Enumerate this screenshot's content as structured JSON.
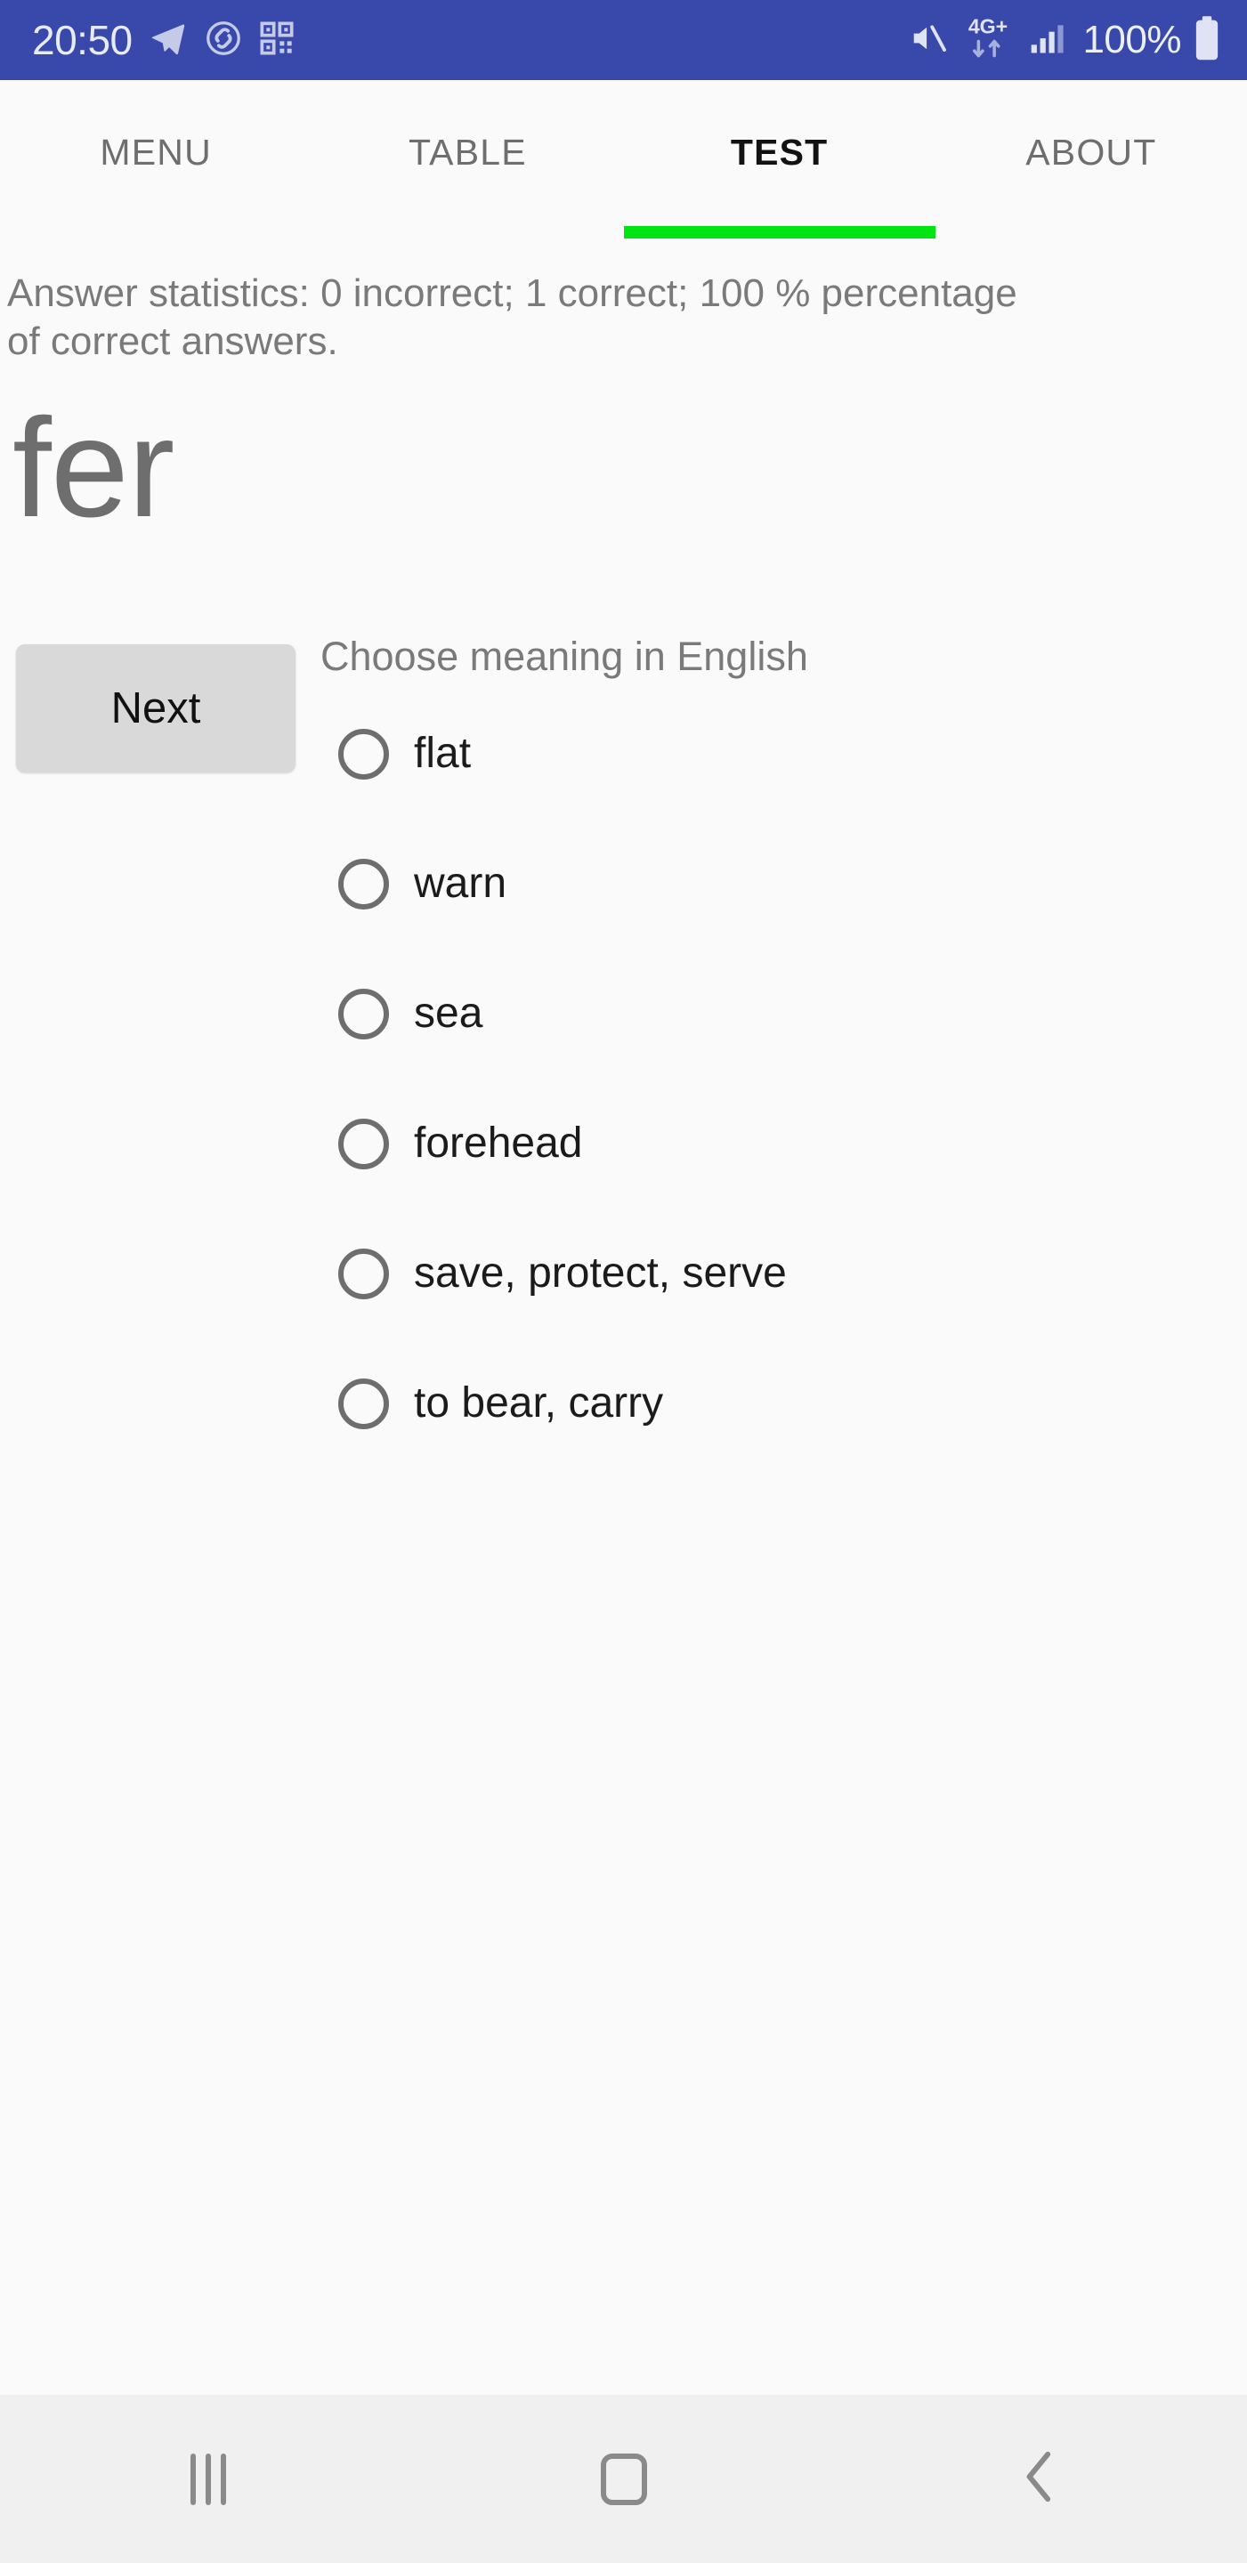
{
  "status_bar": {
    "time": "20:50",
    "battery_percent": "100%",
    "network": "4G+",
    "left_icons": [
      "telegram-icon",
      "shazam-icon",
      "qr-code-icon"
    ],
    "right_icons": [
      "mute-icon",
      "network-4g-plus-icon",
      "signal-bars-icon",
      "battery-icon"
    ],
    "background_color": "#3949ab",
    "text_color": "#e8eaf6"
  },
  "tabs": [
    {
      "label": "MENU",
      "active": false
    },
    {
      "label": "TABLE",
      "active": false
    },
    {
      "label": "TEST",
      "active": true
    },
    {
      "label": "ABOUT",
      "active": false
    }
  ],
  "tab_indicator_color": "#00e512",
  "main": {
    "statistics_text": "Answer statistics: 0 incorrect; 1 correct; 100 % percentage of correct answers.",
    "word": "fer",
    "next_label": "Next",
    "prompt": "Choose meaning in English",
    "options": [
      {
        "label": "flat",
        "selected": false
      },
      {
        "label": "warn",
        "selected": false
      },
      {
        "label": "sea",
        "selected": false
      },
      {
        "label": "forehead",
        "selected": false
      },
      {
        "label": "save, protect, serve",
        "selected": false
      },
      {
        "label": "to bear, carry",
        "selected": false
      }
    ]
  },
  "nav_bar": {
    "recents_label": "recents-icon",
    "home_label": "home-icon",
    "back_label": "back-icon"
  }
}
